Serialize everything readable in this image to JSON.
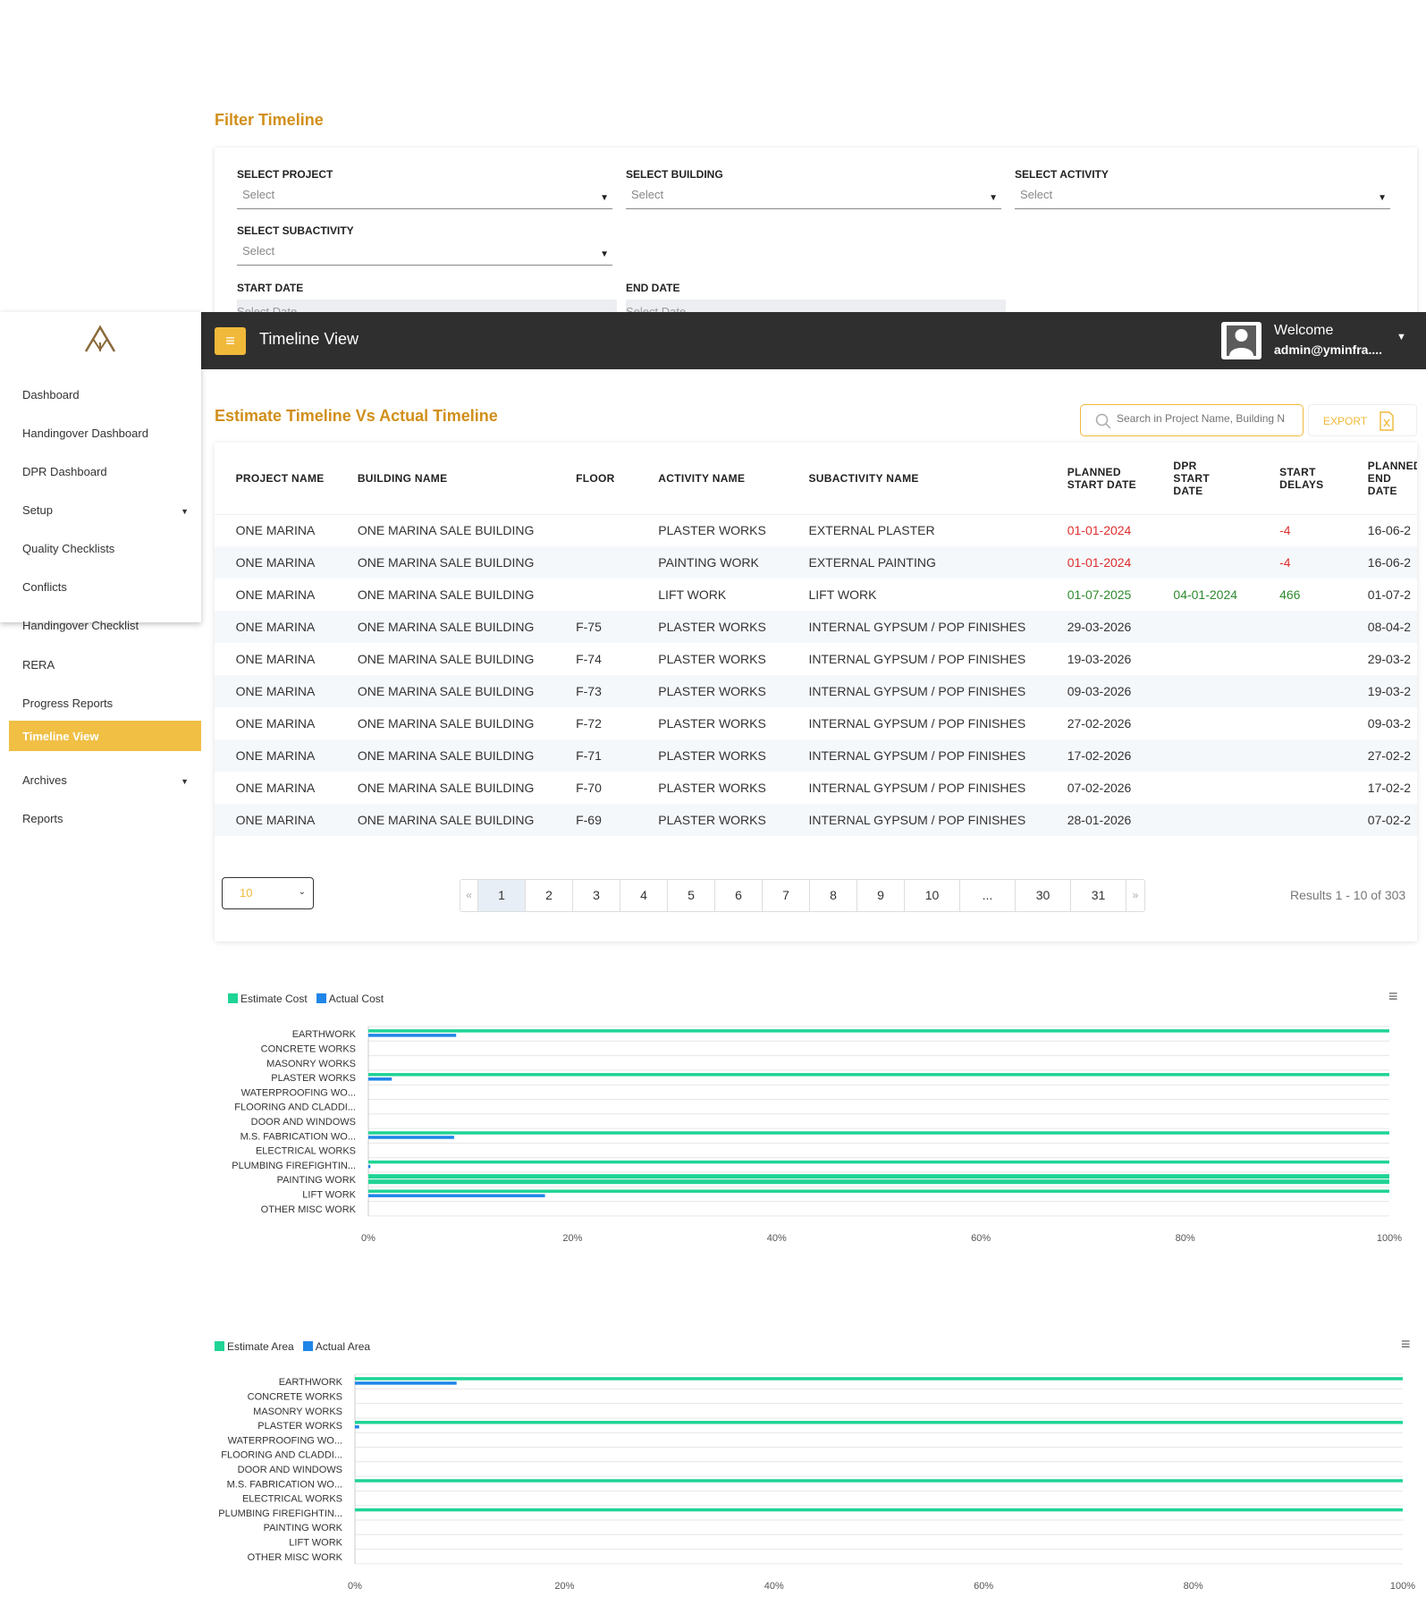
{
  "filter": {
    "title": "Filter Timeline",
    "project_label": "SELECT PROJECT",
    "building_label": "SELECT BUILDING",
    "activity_label": "SELECT ACTIVITY",
    "subactivity_label": "SELECT SUBACTIVITY",
    "start_label": "START DATE",
    "end_label": "END DATE",
    "select_text": "Select",
    "date_placeholder": "Select Date"
  },
  "header": {
    "menu_icon": "hamburger-icon",
    "title": "Timeline View",
    "welcome": "Welcome",
    "user": "admin@yminfra...."
  },
  "sidebar": {
    "items": [
      {
        "label": "Dashboard"
      },
      {
        "label": "Handingover Dashboard"
      },
      {
        "label": "DPR Dashboard"
      },
      {
        "label": "Setup"
      },
      {
        "label": "Quality Checklists"
      },
      {
        "label": "Conflicts"
      },
      {
        "label": "Handingover Checklist"
      },
      {
        "label": "RERA"
      },
      {
        "label": "Progress Reports"
      },
      {
        "label": "Timeline View"
      },
      {
        "label": "Archives"
      },
      {
        "label": "Reports"
      }
    ]
  },
  "main": {
    "title": "Estimate Timeline Vs Actual Timeline",
    "search_placeholder": "Search in Project Name, Building N",
    "export_label": "EXPORT",
    "columns": [
      "PROJECT NAME",
      "BUILDING NAME",
      "FLOOR",
      "ACTIVITY NAME",
      "SUBACTIVITY NAME",
      "PLANNED START DATE",
      "DPR START DATE",
      "START DELAYS",
      "PLANNED END DATE"
    ],
    "rows": [
      [
        "ONE MARINA",
        "ONE MARINA SALE BUILDING",
        "",
        "PLASTER WORKS",
        "EXTERNAL PLASTER",
        "01-01-2024",
        "",
        "-4",
        "16-06-2"
      ],
      [
        "ONE MARINA",
        "ONE MARINA SALE BUILDING",
        "",
        "PAINTING WORK",
        "EXTERNAL PAINTING",
        "01-01-2024",
        "",
        "-4",
        "16-06-2"
      ],
      [
        "ONE MARINA",
        "ONE MARINA SALE BUILDING",
        "",
        "LIFT WORK",
        "LIFT WORK",
        "01-07-2025",
        "04-01-2024",
        "466",
        "01-07-2"
      ],
      [
        "ONE MARINA",
        "ONE MARINA SALE BUILDING",
        "F-75",
        "PLASTER WORKS",
        "INTERNAL GYPSUM / POP FINISHES",
        "29-03-2026",
        "",
        "",
        "08-04-2"
      ],
      [
        "ONE MARINA",
        "ONE MARINA SALE BUILDING",
        "F-74",
        "PLASTER WORKS",
        "INTERNAL GYPSUM / POP FINISHES",
        "19-03-2026",
        "",
        "",
        "29-03-2"
      ],
      [
        "ONE MARINA",
        "ONE MARINA SALE BUILDING",
        "F-73",
        "PLASTER WORKS",
        "INTERNAL GYPSUM / POP FINISHES",
        "09-03-2026",
        "",
        "",
        "19-03-2"
      ],
      [
        "ONE MARINA",
        "ONE MARINA SALE BUILDING",
        "F-72",
        "PLASTER WORKS",
        "INTERNAL GYPSUM / POP FINISHES",
        "27-02-2026",
        "",
        "",
        "09-03-2"
      ],
      [
        "ONE MARINA",
        "ONE MARINA SALE BUILDING",
        "F-71",
        "PLASTER WORKS",
        "INTERNAL GYPSUM / POP FINISHES",
        "17-02-2026",
        "",
        "",
        "27-02-2"
      ],
      [
        "ONE MARINA",
        "ONE MARINA SALE BUILDING",
        "F-70",
        "PLASTER WORKS",
        "INTERNAL GYPSUM / POP FINISHES",
        "07-02-2026",
        "",
        "",
        "17-02-2"
      ],
      [
        "ONE MARINA",
        "ONE MARINA SALE BUILDING",
        "F-69",
        "PLASTER WORKS",
        "INTERNAL GYPSUM / POP FINISHES",
        "28-01-2026",
        "",
        "",
        "07-02-2"
      ]
    ],
    "row_status": [
      {
        "planned": "red",
        "delay": "red"
      },
      {
        "planned": "red",
        "delay": "red"
      },
      {
        "planned": "green",
        "dpr": "green",
        "delay": "green"
      }
    ],
    "page_size": "10",
    "pagination": [
      "«",
      "1",
      "2",
      "3",
      "4",
      "5",
      "6",
      "7",
      "8",
      "9",
      "10",
      "...",
      "30",
      "31",
      "»"
    ],
    "current_page": "1",
    "results": "Results 1 - 10 of 303"
  },
  "colors": {
    "accent": "#f0b93a",
    "title": "#d18f1a",
    "header_bg": "#2f2f2f",
    "estimate": "#1ed494",
    "actual": "#1f86e8"
  },
  "chart_data": [
    {
      "type": "bar",
      "orientation": "horizontal",
      "categories": [
        "EARTHWORK",
        "CONCRETE WORKS",
        "MASONRY WORKS",
        "PLASTER WORKS",
        "WATERPROOFING WO...",
        "FLOORING AND CLADDI...",
        "DOOR AND WINDOWS",
        "M.S. FABRICATION WO...",
        "ELECTRICAL WORKS",
        "PLUMBING FIREFIGHTIN...",
        "PAINTING WORK",
        "LIFT WORK",
        "OTHER MISC WORK"
      ],
      "series": [
        {
          "name": "Estimate Cost",
          "values": [
            100,
            0,
            0,
            100,
            0,
            0,
            0,
            100,
            0,
            100,
            100,
            100,
            0
          ]
        },
        {
          "name": "Actual Cost",
          "values": [
            8.6,
            0,
            0,
            2.3,
            0,
            0,
            0,
            8.4,
            0,
            0.2,
            100,
            17.3,
            0
          ]
        }
      ],
      "xticks": [
        "0%",
        "20%",
        "40%",
        "60%",
        "80%",
        "100%"
      ],
      "xlim": [
        0,
        100
      ],
      "legend": "top-left",
      "grid": true
    },
    {
      "type": "bar",
      "orientation": "horizontal",
      "categories": [
        "EARTHWORK",
        "CONCRETE WORKS",
        "MASONRY WORKS",
        "PLASTER WORKS",
        "WATERPROOFING WO...",
        "FLOORING AND CLADDI...",
        "DOOR AND WINDOWS",
        "M.S. FABRICATION WO...",
        "ELECTRICAL WORKS",
        "PLUMBING FIREFIGHTIN...",
        "PAINTING WORK",
        "LIFT WORK",
        "OTHER MISC WORK"
      ],
      "series": [
        {
          "name": "Estimate Area",
          "values": [
            100,
            0,
            0,
            100,
            0,
            0,
            0,
            100,
            0,
            100,
            0,
            0,
            0
          ]
        },
        {
          "name": "Actual Area",
          "values": [
            9.7,
            0,
            0,
            0.4,
            0,
            0,
            0,
            0,
            0,
            0,
            0,
            0,
            0
          ]
        }
      ],
      "xticks": [
        "0%",
        "20%",
        "40%",
        "60%",
        "80%",
        "100%"
      ],
      "xlim": [
        0,
        100
      ],
      "legend": "top-left",
      "grid": true
    }
  ]
}
